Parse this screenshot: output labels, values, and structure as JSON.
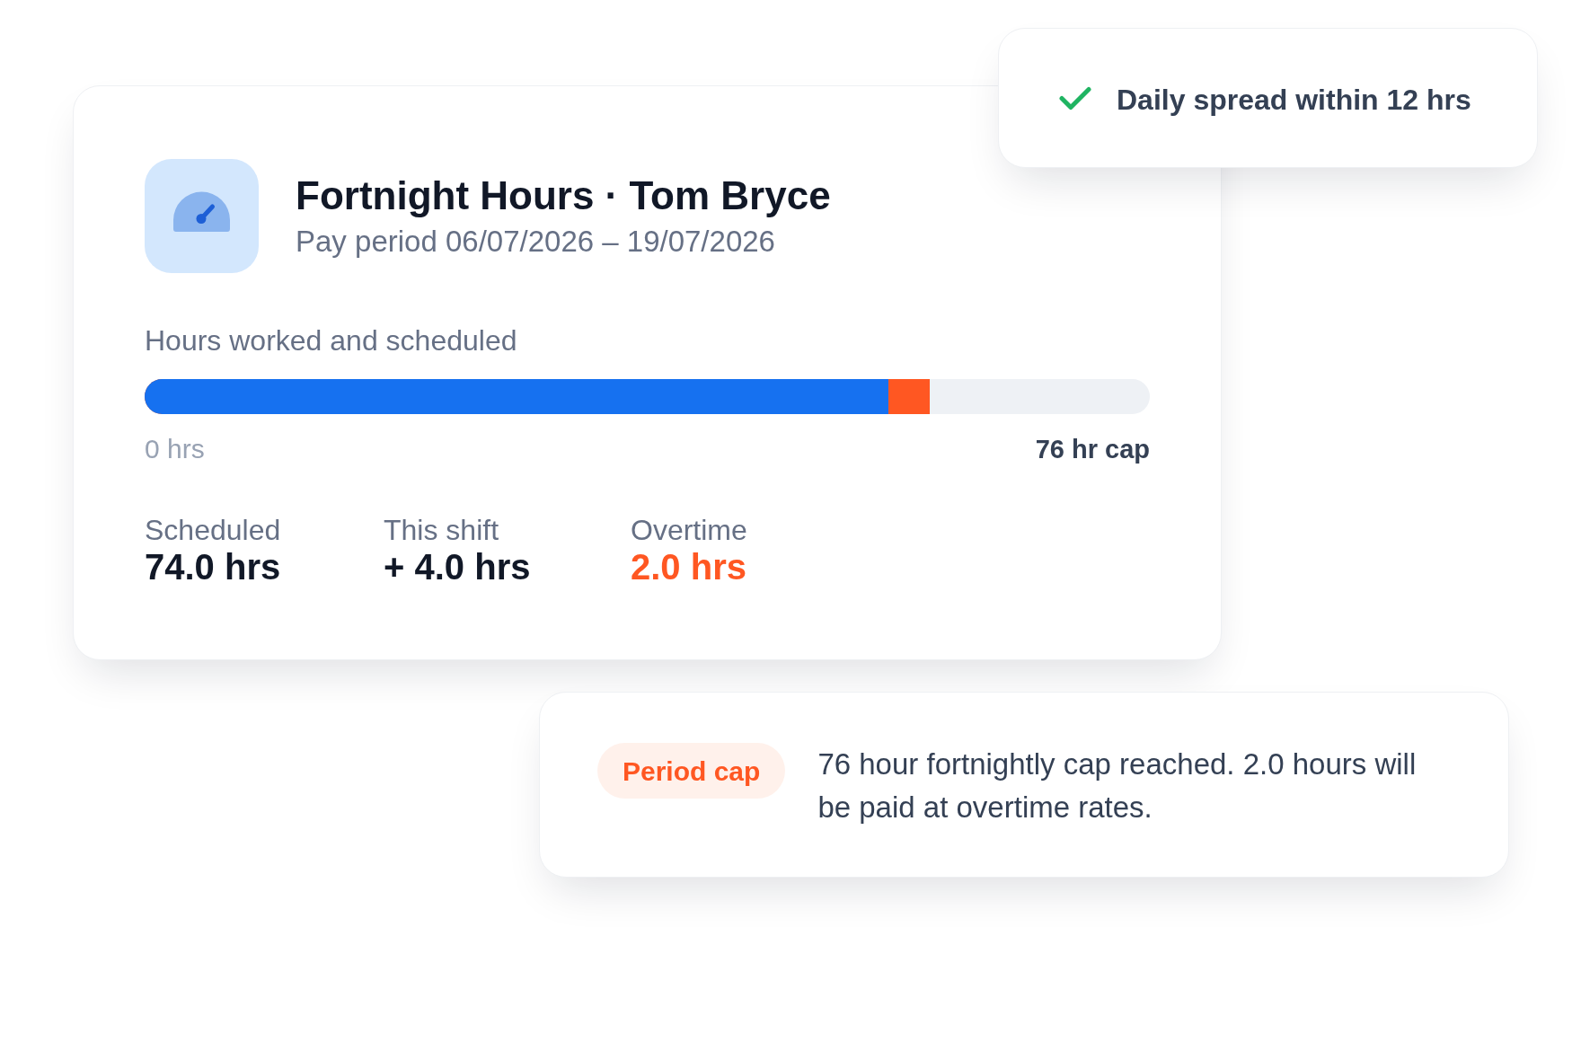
{
  "summary_card": {
    "title": "Fortnight Hours · Tom Bryce",
    "subtitle": "Pay period 06/07/2026 – 19/07/2026",
    "progress": {
      "label": "Hours worked and scheduled",
      "fills": [
        {
          "kind": "with_shift",
          "level": 0.781,
          "color": "#ff5722"
        },
        {
          "kind": "scheduled",
          "level": 0.74,
          "color": "#1671f0"
        }
      ],
      "min_label": "0 hrs",
      "max_label": "76 hr cap"
    },
    "stats": [
      {
        "label": "Scheduled",
        "value": "74.0 hrs",
        "kind": "normal"
      },
      {
        "label": "This shift",
        "value": "+ 4.0 hrs",
        "kind": "normal"
      },
      {
        "label": "Overtime",
        "value": "2.0 hrs",
        "kind": "warning"
      }
    ]
  },
  "toast": {
    "text": "Daily spread within 12 hrs"
  },
  "alert": {
    "badge": "Period cap",
    "message": "76 hour fortnightly cap reached. 2.0 hours will be paid at overtime rates."
  }
}
